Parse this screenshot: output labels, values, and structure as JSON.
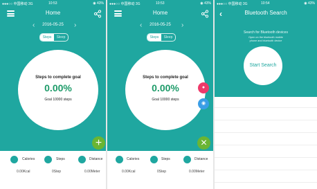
{
  "colors": {
    "teal": "#1fa7a0",
    "green_fab": "#6ab533",
    "pink_fab": "#ee3a6a",
    "blue_fab": "#3a9ee6",
    "percent_green": "#1d9b69"
  },
  "home1": {
    "status": {
      "carrier": "●●●○○ 中国移动 3G",
      "time": "10:53",
      "battery": "◉ 43%"
    },
    "nav": {
      "title": "Home",
      "left_icon": "menu-icon",
      "right_icon": "share-icon"
    },
    "date": {
      "prev": "‹",
      "text": "2016-05-25",
      "next": "›"
    },
    "toggle": {
      "on": "Steps",
      "off": "Sleep"
    },
    "goal": {
      "title": "Steps to complete goal",
      "percent": "0.00%",
      "subtitle": "Goal 10000 steps"
    },
    "fab": {
      "symbol": "+",
      "icon": "add-icon"
    },
    "stats": [
      {
        "label": "Calories",
        "value": "0.00Kcal",
        "icon": "calories-icon"
      },
      {
        "label": "Steps",
        "value": "0Step",
        "icon": "steps-icon"
      },
      {
        "label": "Distance",
        "value": "0.00Meter",
        "icon": "distance-icon"
      }
    ]
  },
  "home2": {
    "status": {
      "carrier": "●●●○○ 中国移动 3G",
      "time": "10:53",
      "battery": "◉ 43%"
    },
    "nav": {
      "title": "Home",
      "left_icon": "menu-icon",
      "right_icon": "share-icon"
    },
    "date": {
      "prev": "‹",
      "text": "2016-05-25",
      "next": "›"
    },
    "toggle": {
      "on": "Steps",
      "off": "Sleep"
    },
    "goal": {
      "title": "Steps to complete goal",
      "percent": "0.00%",
      "subtitle": "Goal 10000 steps"
    },
    "fab": {
      "symbol": "×",
      "icon": "close-icon"
    },
    "mini_fabs": [
      {
        "symbol": "●",
        "icon": "bluetooth-icon"
      },
      {
        "symbol": "◉",
        "icon": "sync-icon"
      }
    ],
    "stats": [
      {
        "label": "Calories",
        "value": "0.00Kcal",
        "icon": "calories-icon"
      },
      {
        "label": "Steps",
        "value": "0Step",
        "icon": "steps-icon"
      },
      {
        "label": "Distance",
        "value": "0.00Meter",
        "icon": "distance-icon"
      }
    ]
  },
  "bluetooth": {
    "status": {
      "carrier": "●●●○○ 中国移动 3G",
      "time": "10:54",
      "battery": "◉ 43%"
    },
    "nav": {
      "title": "Bluetooth Search",
      "back": "‹"
    },
    "desc": {
      "line1": "Search for Bluetooth devices",
      "line2": "Open on the bluetooth mobile",
      "line3": "phone and bluetooth device"
    },
    "button": "Start Search"
  }
}
